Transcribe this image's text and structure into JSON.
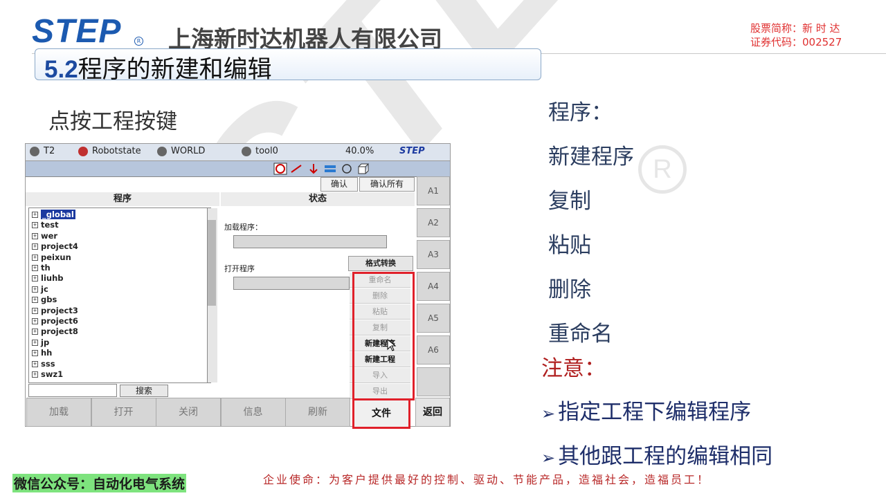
{
  "header": {
    "logo": "STEP",
    "company": "上海新时达机器人有限公司",
    "stock_name": "股票简称：新 时 达",
    "stock_code": "证券代码：002527"
  },
  "slide": {
    "title_num": "5.2",
    "title_text": "程序的新建和编辑",
    "subtitle": "点按工程按键"
  },
  "screen": {
    "status": {
      "mode": "T2",
      "robotstate": "Robotstate",
      "coord": "WORLD",
      "tool": "tool0",
      "speed": "40.0%",
      "brand": "STEP"
    },
    "confirm": "确认",
    "confirm_all": "确认所有",
    "col_program": "程序",
    "col_state": "状态",
    "tree": [
      "_global",
      "test",
      "wer",
      "project4",
      "peixun",
      "th",
      "liuhb",
      "jc",
      "gbs",
      "project3",
      "project6",
      "project8",
      "jp",
      "hh",
      "sss",
      "swz1"
    ],
    "load_label": "加载程序：",
    "open_label": "打开程序",
    "search": "搜索",
    "format": "格式转换",
    "menu": [
      "重命名",
      "删除",
      "粘贴",
      "复制",
      "新建程序",
      "新建工程",
      "导入",
      "导出"
    ],
    "side_buttons": [
      "A1",
      "A2",
      "A3",
      "A4",
      "A5",
      "A6"
    ],
    "bottom": [
      "加载",
      "打开",
      "关闭",
      "信息",
      "刷新"
    ],
    "file": "文件",
    "back": "返回"
  },
  "right": {
    "items": [
      "程序：",
      "新建程序",
      "复制",
      "粘贴",
      "删除",
      "重命名"
    ],
    "note": "注意：",
    "bullets": [
      "指定工程下编辑程序",
      "其他跟工程的编辑相同"
    ]
  },
  "footer": {
    "wechat": "微信公众号：自动化电气系统",
    "mission": "企业使命：为客户提供最好的控制、驱动、节能产品，造福社会，造福员工！"
  },
  "colors": {
    "brand_blue": "#1c5ab0",
    "highlight_red": "#e0202a",
    "note_red": "#b02020"
  }
}
